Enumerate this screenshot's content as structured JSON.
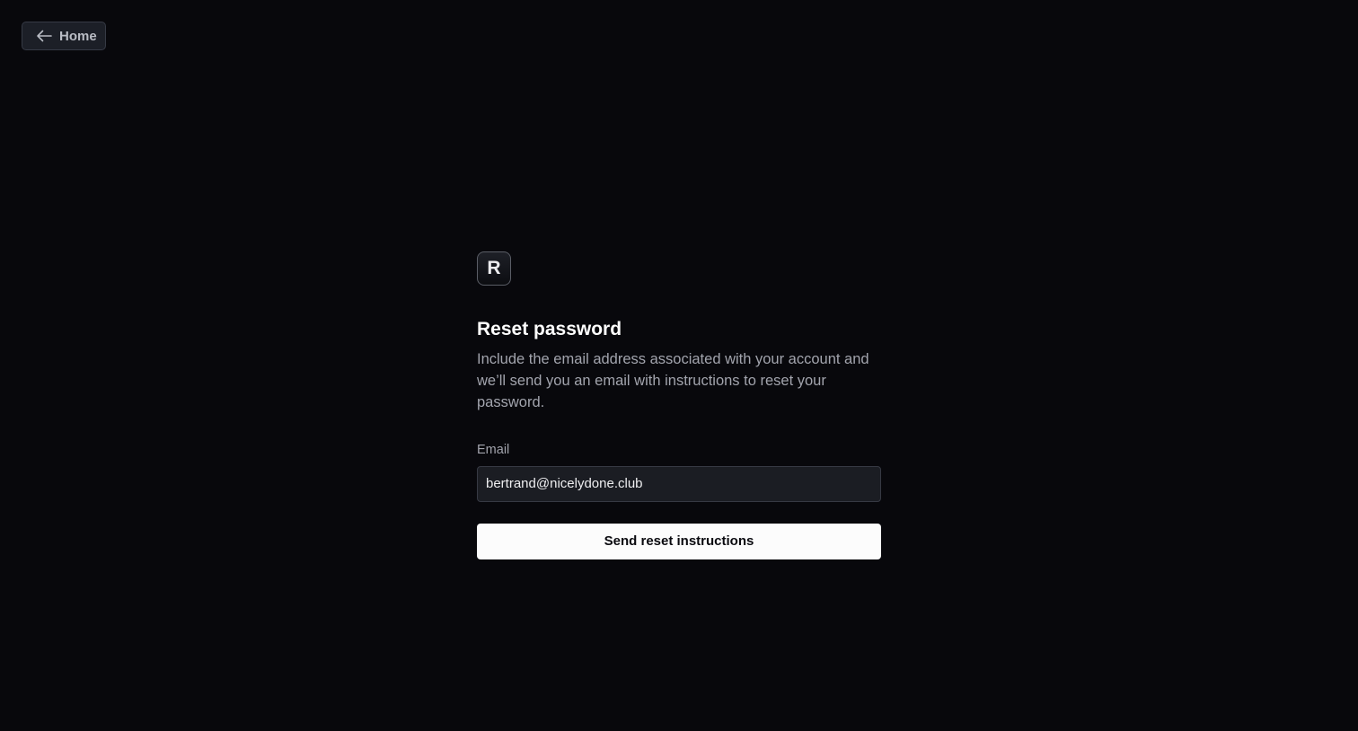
{
  "nav": {
    "home_label": "Home",
    "home_icon": "arrow-left-icon"
  },
  "logo": {
    "letter": "R"
  },
  "form": {
    "title": "Reset password",
    "description": "Include the email address associated with your account and we’ll send you an email with instructions to reset your password.",
    "email_label": "Email",
    "email_value": "bertrand@nicelydone.club",
    "submit_label": "Send reset instructions"
  },
  "colors": {
    "background": "#08080c",
    "button_primary": "#fcfcfc",
    "input_background": "#1b1d23"
  }
}
